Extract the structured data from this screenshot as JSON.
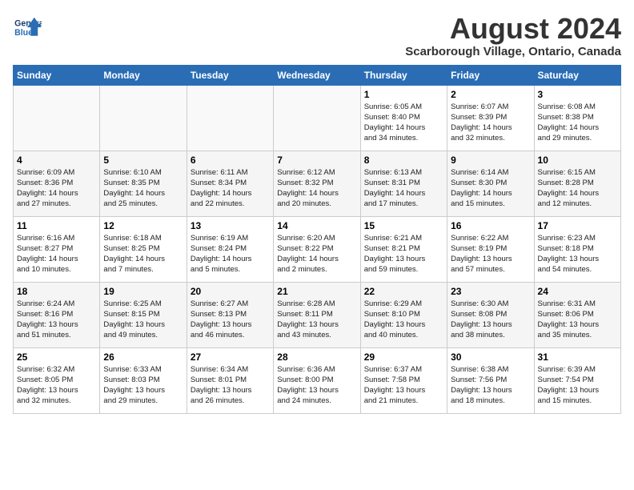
{
  "logo": {
    "line1": "General",
    "line2": "Blue"
  },
  "title": "August 2024",
  "subtitle": "Scarborough Village, Ontario, Canada",
  "days_of_week": [
    "Sunday",
    "Monday",
    "Tuesday",
    "Wednesday",
    "Thursday",
    "Friday",
    "Saturday"
  ],
  "weeks": [
    [
      {
        "day": "",
        "content": ""
      },
      {
        "day": "",
        "content": ""
      },
      {
        "day": "",
        "content": ""
      },
      {
        "day": "",
        "content": ""
      },
      {
        "day": "1",
        "content": "Sunrise: 6:05 AM\nSunset: 8:40 PM\nDaylight: 14 hours\nand 34 minutes."
      },
      {
        "day": "2",
        "content": "Sunrise: 6:07 AM\nSunset: 8:39 PM\nDaylight: 14 hours\nand 32 minutes."
      },
      {
        "day": "3",
        "content": "Sunrise: 6:08 AM\nSunset: 8:38 PM\nDaylight: 14 hours\nand 29 minutes."
      }
    ],
    [
      {
        "day": "4",
        "content": "Sunrise: 6:09 AM\nSunset: 8:36 PM\nDaylight: 14 hours\nand 27 minutes."
      },
      {
        "day": "5",
        "content": "Sunrise: 6:10 AM\nSunset: 8:35 PM\nDaylight: 14 hours\nand 25 minutes."
      },
      {
        "day": "6",
        "content": "Sunrise: 6:11 AM\nSunset: 8:34 PM\nDaylight: 14 hours\nand 22 minutes."
      },
      {
        "day": "7",
        "content": "Sunrise: 6:12 AM\nSunset: 8:32 PM\nDaylight: 14 hours\nand 20 minutes."
      },
      {
        "day": "8",
        "content": "Sunrise: 6:13 AM\nSunset: 8:31 PM\nDaylight: 14 hours\nand 17 minutes."
      },
      {
        "day": "9",
        "content": "Sunrise: 6:14 AM\nSunset: 8:30 PM\nDaylight: 14 hours\nand 15 minutes."
      },
      {
        "day": "10",
        "content": "Sunrise: 6:15 AM\nSunset: 8:28 PM\nDaylight: 14 hours\nand 12 minutes."
      }
    ],
    [
      {
        "day": "11",
        "content": "Sunrise: 6:16 AM\nSunset: 8:27 PM\nDaylight: 14 hours\nand 10 minutes."
      },
      {
        "day": "12",
        "content": "Sunrise: 6:18 AM\nSunset: 8:25 PM\nDaylight: 14 hours\nand 7 minutes."
      },
      {
        "day": "13",
        "content": "Sunrise: 6:19 AM\nSunset: 8:24 PM\nDaylight: 14 hours\nand 5 minutes."
      },
      {
        "day": "14",
        "content": "Sunrise: 6:20 AM\nSunset: 8:22 PM\nDaylight: 14 hours\nand 2 minutes."
      },
      {
        "day": "15",
        "content": "Sunrise: 6:21 AM\nSunset: 8:21 PM\nDaylight: 13 hours\nand 59 minutes."
      },
      {
        "day": "16",
        "content": "Sunrise: 6:22 AM\nSunset: 8:19 PM\nDaylight: 13 hours\nand 57 minutes."
      },
      {
        "day": "17",
        "content": "Sunrise: 6:23 AM\nSunset: 8:18 PM\nDaylight: 13 hours\nand 54 minutes."
      }
    ],
    [
      {
        "day": "18",
        "content": "Sunrise: 6:24 AM\nSunset: 8:16 PM\nDaylight: 13 hours\nand 51 minutes."
      },
      {
        "day": "19",
        "content": "Sunrise: 6:25 AM\nSunset: 8:15 PM\nDaylight: 13 hours\nand 49 minutes."
      },
      {
        "day": "20",
        "content": "Sunrise: 6:27 AM\nSunset: 8:13 PM\nDaylight: 13 hours\nand 46 minutes."
      },
      {
        "day": "21",
        "content": "Sunrise: 6:28 AM\nSunset: 8:11 PM\nDaylight: 13 hours\nand 43 minutes."
      },
      {
        "day": "22",
        "content": "Sunrise: 6:29 AM\nSunset: 8:10 PM\nDaylight: 13 hours\nand 40 minutes."
      },
      {
        "day": "23",
        "content": "Sunrise: 6:30 AM\nSunset: 8:08 PM\nDaylight: 13 hours\nand 38 minutes."
      },
      {
        "day": "24",
        "content": "Sunrise: 6:31 AM\nSunset: 8:06 PM\nDaylight: 13 hours\nand 35 minutes."
      }
    ],
    [
      {
        "day": "25",
        "content": "Sunrise: 6:32 AM\nSunset: 8:05 PM\nDaylight: 13 hours\nand 32 minutes."
      },
      {
        "day": "26",
        "content": "Sunrise: 6:33 AM\nSunset: 8:03 PM\nDaylight: 13 hours\nand 29 minutes."
      },
      {
        "day": "27",
        "content": "Sunrise: 6:34 AM\nSunset: 8:01 PM\nDaylight: 13 hours\nand 26 minutes."
      },
      {
        "day": "28",
        "content": "Sunrise: 6:36 AM\nSunset: 8:00 PM\nDaylight: 13 hours\nand 24 minutes."
      },
      {
        "day": "29",
        "content": "Sunrise: 6:37 AM\nSunset: 7:58 PM\nDaylight: 13 hours\nand 21 minutes."
      },
      {
        "day": "30",
        "content": "Sunrise: 6:38 AM\nSunset: 7:56 PM\nDaylight: 13 hours\nand 18 minutes."
      },
      {
        "day": "31",
        "content": "Sunrise: 6:39 AM\nSunset: 7:54 PM\nDaylight: 13 hours\nand 15 minutes."
      }
    ]
  ]
}
